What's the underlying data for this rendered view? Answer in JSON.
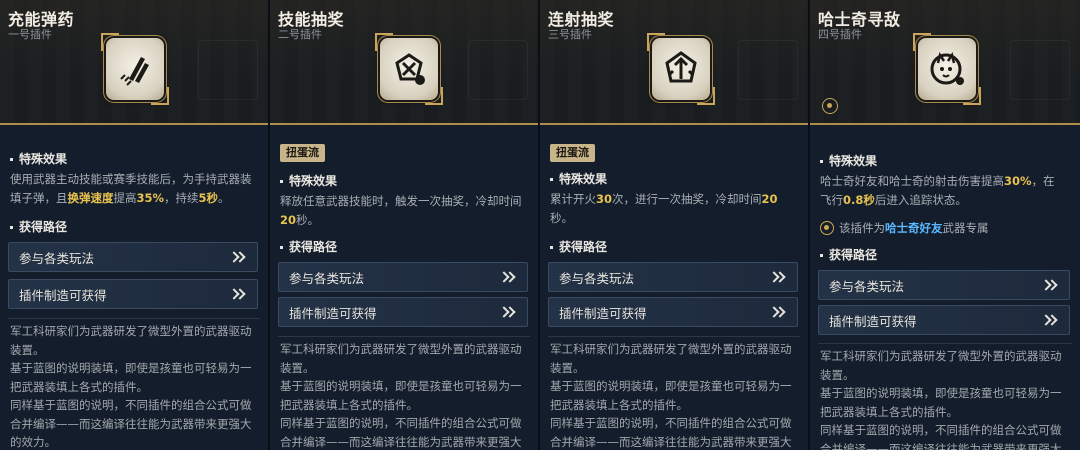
{
  "cards": [
    {
      "title": "充能弹药",
      "subtitle": "一号插件",
      "icon": "rocket-ammo-icon",
      "tag": "",
      "effect_heading": "特殊效果",
      "effect_parts": [
        "使用武器主动技能或赛季技能后，为手持武器装填子弹，且",
        "换弹速度",
        "提高",
        "35%",
        "，持续",
        "5秒",
        "。"
      ],
      "route_heading": "获得路径",
      "routes": [
        "参与各类玩法",
        "插件制造可获得"
      ],
      "lore": [
        "军工科研家们为武器研发了微型外置的武器驱动装置。",
        "基于蓝图的说明装填，即使是孩童也可轻易为一把武器装填上各式的插件。",
        "同样基于蓝图的说明，不同插件的组合公式可做合并编译——而这编译往往能为武器带来更强大的效力。"
      ]
    },
    {
      "title": "技能抽奖",
      "subtitle": "二号插件",
      "icon": "skill-lottery-icon",
      "tag": "扭蛋流",
      "effect_heading": "特殊效果",
      "effect_parts": [
        "释放任意武器技能时，触发一次抽奖，冷却时间",
        "20",
        "秒。"
      ],
      "route_heading": "获得路径",
      "routes": [
        "参与各类玩法",
        "插件制造可获得"
      ],
      "lore": [
        "军工科研家们为武器研发了微型外置的武器驱动装置。",
        "基于蓝图的说明装填，即使是孩童也可轻易为一把武器装填上各式的插件。",
        "同样基于蓝图的说明，不同插件的组合公式可做合并编译——而这编译往往能为武器带来更强大"
      ]
    },
    {
      "title": "连射抽奖",
      "subtitle": "三号插件",
      "icon": "burst-lottery-icon",
      "tag": "扭蛋流",
      "effect_heading": "特殊效果",
      "effect_parts": [
        "累计开火",
        "30",
        "次，进行一次抽奖，冷却时间",
        "20",
        "秒。"
      ],
      "route_heading": "获得路径",
      "routes": [
        "参与各类玩法",
        "插件制造可获得"
      ],
      "lore": [
        "军工科研家们为武器研发了微型外置的武器驱动装置。",
        "基于蓝图的说明装填，即使是孩童也可轻易为一把武器装填上各式的插件。",
        "同样基于蓝图的说明，不同插件的组合公式可做合并编译——而这编译往往能为武器带来更强大"
      ]
    },
    {
      "title": "哈士奇寻敌",
      "subtitle": "四号插件",
      "icon": "husky-icon",
      "tag": "",
      "effect_heading": "特殊效果",
      "effect_parts": [
        "哈士奇好友和哈士奇的射击伤害提高",
        "30%",
        "，在飞行",
        "0.8秒",
        "后进入追踪状态。"
      ],
      "exclusive_pre": "该插件为",
      "exclusive_weapon": "哈士奇好友",
      "exclusive_post": "武器专属",
      "route_heading": "获得路径",
      "routes": [
        "参与各类玩法",
        "插件制造可获得"
      ],
      "lore": [
        "军工科研家们为武器研发了微型外置的武器驱动装置。",
        "基于蓝图的说明装填，即使是孩童也可轻易为一把武器装填上各式的插件。",
        "同样基于蓝图的说明，不同插件的组合公式可做合并编译——而这编译往往能为武器带来更强大"
      ]
    }
  ],
  "colors": {
    "highlight": "#e8c24e",
    "link": "#59b8ff",
    "gold_border": "#b08d48"
  }
}
